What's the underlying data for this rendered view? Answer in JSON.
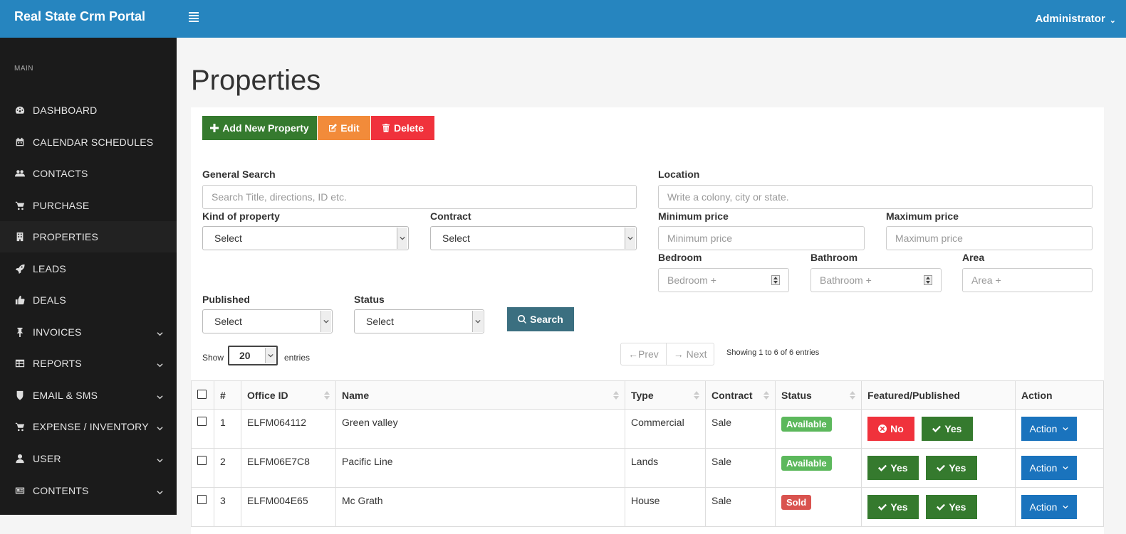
{
  "app": {
    "title": "Real State Crm Portal",
    "user": "Administrator"
  },
  "sidebar": {
    "section": "MAIN",
    "items": [
      {
        "label": "DASHBOARD",
        "icon": "dashboard-icon"
      },
      {
        "label": "CALENDAR SCHEDULES",
        "icon": "calendar-icon"
      },
      {
        "label": "CONTACTS",
        "icon": "users-icon"
      },
      {
        "label": "PURCHASE",
        "icon": "cart-icon"
      },
      {
        "label": "PROPERTIES",
        "icon": "building-icon"
      },
      {
        "label": "LEADS",
        "icon": "rocket-icon"
      },
      {
        "label": "DEALS",
        "icon": "thumbs-up-icon"
      },
      {
        "label": "INVOICES",
        "icon": "pin-icon"
      },
      {
        "label": "REPORTS",
        "icon": "table-icon"
      },
      {
        "label": "EMAIL & SMS",
        "icon": "shield-icon"
      },
      {
        "label": "EXPENSE / INVENTORY",
        "icon": "cart-icon"
      },
      {
        "label": "USER",
        "icon": "user-icon"
      },
      {
        "label": "CONTENTS",
        "icon": "newspaper-icon"
      }
    ]
  },
  "page": {
    "title": "Properties"
  },
  "toolbar": {
    "add_label": "Add New Property",
    "edit_label": "Edit",
    "delete_label": "Delete"
  },
  "filters": {
    "general_search": {
      "label": "General Search",
      "placeholder": "Search Title, directions, ID etc."
    },
    "location": {
      "label": "Location",
      "placeholder": "Write a colony, city or state."
    },
    "kind": {
      "label": "Kind of property",
      "value": "Select"
    },
    "contract": {
      "label": "Contract",
      "value": "Select"
    },
    "min_price": {
      "label": "Minimum price",
      "placeholder": "Minimum price"
    },
    "max_price": {
      "label": "Maximum price",
      "placeholder": "Maximum price"
    },
    "bedroom": {
      "label": "Bedroom",
      "placeholder": "Bedroom +"
    },
    "bathroom": {
      "label": "Bathroom",
      "placeholder": "Bathroom +"
    },
    "area": {
      "label": "Area",
      "placeholder": "Area +"
    },
    "published": {
      "label": "Published",
      "value": "Select"
    },
    "status": {
      "label": "Status",
      "value": "Select"
    },
    "search_label": "Search"
  },
  "list": {
    "show_label": "Show",
    "page_size": "20",
    "entries_label": "entries",
    "prev_label": "←Prev",
    "next_label": "→ Next",
    "showing": "Showing 1 to 6 of 6 entries"
  },
  "table": {
    "headers": [
      "#",
      "Office ID",
      "Name",
      "Type",
      "Contract",
      "Status",
      "Featured/Published",
      "Action"
    ],
    "rows": [
      {
        "num": "1",
        "office_id": "ELFM064112",
        "name": "Green valley",
        "type": "Commercial",
        "contract": "Sale",
        "status": "Available",
        "featured": "No",
        "published": "Yes",
        "action": "Action"
      },
      {
        "num": "2",
        "office_id": "ELFM06E7C8",
        "name": "Pacific Line",
        "type": "Lands",
        "contract": "Sale",
        "status": "Available",
        "featured": "Yes",
        "published": "Yes",
        "action": "Action"
      },
      {
        "num": "3",
        "office_id": "ELFM004E65",
        "name": "Mc Grath",
        "type": "House",
        "contract": "Sale",
        "status": "Sold",
        "featured": "Yes",
        "published": "Yes",
        "action": "Action"
      }
    ]
  },
  "colors": {
    "topbar": "#2685bf",
    "sidebar": "#1b1b1b",
    "add": "#357a2e",
    "edit": "#f28b3a",
    "delete": "#f0323c",
    "search": "#3b6f80",
    "action": "#1a73bd"
  }
}
